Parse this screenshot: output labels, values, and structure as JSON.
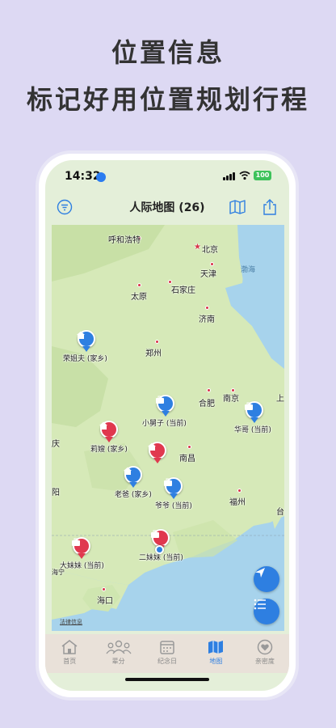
{
  "promo": {
    "line1": "位置信息",
    "line2": "标记好用位置规划行程"
  },
  "status": {
    "time": "14:32",
    "battery": "100"
  },
  "nav": {
    "title": "人际地图 (26)"
  },
  "map": {
    "cities": {
      "huhehaote": "呼和浩特",
      "beijing": "北京",
      "tianjin": "天津",
      "taiyuan": "太原",
      "shijiazhuang": "石家庄",
      "jinan": "济南",
      "zhengzhou": "郑州",
      "hefei": "合肥",
      "nanjing": "南京",
      "nanchang": "南昌",
      "fuzhou": "福州",
      "haikou": "海口",
      "qing": "庆",
      "yang": "阳",
      "tai": "台",
      "shang": "上",
      "haining": "海宁"
    },
    "seas": {
      "bohai": "渤海"
    },
    "pins": {
      "rongjiefu": "荣姐夫 (家乡)",
      "xiaoyizi": "小舅子 (当前)",
      "huage": "华哥 (当前)",
      "lisao": "莉嫂 (家乡)",
      "laoba": "老爸 (家乡)",
      "yeye": "爷爷 (当前)",
      "dameimei": "大妹妹 (当前)",
      "ermei": "二妹妹 (当前)"
    },
    "legal": "法律信息"
  },
  "tabs": [
    {
      "label": "首页",
      "icon": "home-icon"
    },
    {
      "label": "辈分",
      "icon": "people-icon"
    },
    {
      "label": "纪念日",
      "icon": "calendar-icon"
    },
    {
      "label": "地图",
      "icon": "map-icon"
    },
    {
      "label": "亲密度",
      "icon": "heart-icon"
    }
  ],
  "colors": {
    "accent": "#2e7fe1",
    "pin_red": "#e0384e",
    "background": "#ddd9f3",
    "land": "#d6e9b8",
    "sea": "#a7d3ec"
  }
}
